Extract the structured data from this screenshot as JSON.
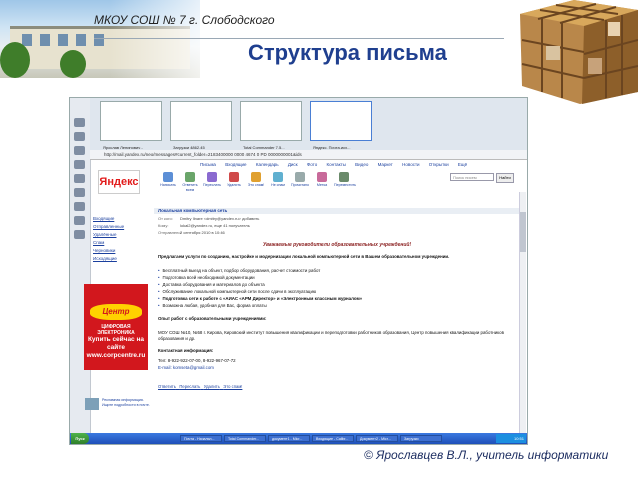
{
  "slide": {
    "school": "МКОУ СОШ № 7 г. Слободского",
    "title": "Структура письма",
    "credit": "© Ярославцев В.Л., учитель информатики"
  },
  "browser": {
    "tabs": [
      "Ярослав Ленинович -",
      "Загрузки 4862.45",
      "Total Commander 7.5...",
      "Яндекс. Почта.исх..."
    ],
    "address": "http://mail.yandex.ru/neo/messages#current_folder=2183400000 0000 4674 0 PD 0000000001&ids",
    "menu": [
      "Письма",
      "Входящие",
      "Календарь",
      "Диск",
      "Фото",
      "Контакты",
      "Видео",
      "Маркет",
      "Новости",
      "Открытки",
      "Ещё"
    ]
  },
  "mail": {
    "logo": "Яндекс",
    "toolbar": [
      "Написать",
      "Ответить всем",
      "Переслать",
      "Удалить",
      "Это спам!",
      "Не спам",
      "Прочитано",
      "Метка",
      "Переместить"
    ],
    "search_placeholder": "Поиск писем",
    "search_button": "Найти",
    "right_links": [
      "Переслать",
      "Перенести",
      "Дополнительно"
    ],
    "folders": [
      "Входящие",
      "Отправленные",
      "Удалённые",
      "Спам",
      "Черновики",
      "Исходящие"
    ],
    "ad": {
      "brand": "Центр",
      "line1": "ЦИФРОВАЯ ЭЛЕКТРОНИКА",
      "line2": "Купить сейчас на сайте www.corpcentre.ru"
    },
    "news": "Рекламная информация. Ищите подробности в почте.",
    "subject": "Локальная компьютерная сеть",
    "header_rows": [
      {
        "label": "От кого:",
        "value": "Dmitry Ilnare <dmitry@yandex.ru> добавить"
      },
      {
        "label": "Кому:",
        "value": "lokal2@yandex.ru, еще 41 получатель"
      },
      {
        "label": "Отправлено:",
        "value": "2 сентября 2010 в 10:46"
      }
    ],
    "greeting": "Уважаемые руководители образовательных учреждений!",
    "intro": "Предлагаем услуги по созданию, настройке и модернизации локальной компьютерной сети в Вашем образовательном учреждении.",
    "bullets": [
      "Бесплатный выезд на объект, подбор оборудования, расчет стоимости работ",
      "Подготовка всей необходимой документации",
      "Доставка оборудования и материалов до объекта",
      "Обслуживание локальной компьютерной сети после сдачи в эксплуатацию",
      "Подготовка сети к работе с «АИАС «АРМ Директор» и «Электронным классным журналом»",
      "Возможна любая, удобная для Вас, форма оплаты"
    ],
    "experience_title": "Опыт работ с образовательными учреждениями:",
    "experience": "МОУ СОШ №10, №58 г. Кирова, Кировский институт повышения квалификации и переподготовки работников образования, Центр повышения квалификации работников образования и др.",
    "contacts_title": "Контактная информация:",
    "contacts": [
      "Тел: 8-922-922-07-00, 8-922-967-07-72",
      "E-mail: komseta@gmail.com"
    ],
    "actions": [
      "Ответить",
      "Переслать",
      "Удалить",
      "Это спам!"
    ]
  },
  "taskbar": {
    "start": "Пуск",
    "tasks": [
      "Почта - Начальн...",
      "Total Commander...",
      "документ1 - Micr...",
      "Входящие - Calibr...",
      "Документ2 - Micr...",
      "Загрузки"
    ],
    "clock": "10:51"
  }
}
